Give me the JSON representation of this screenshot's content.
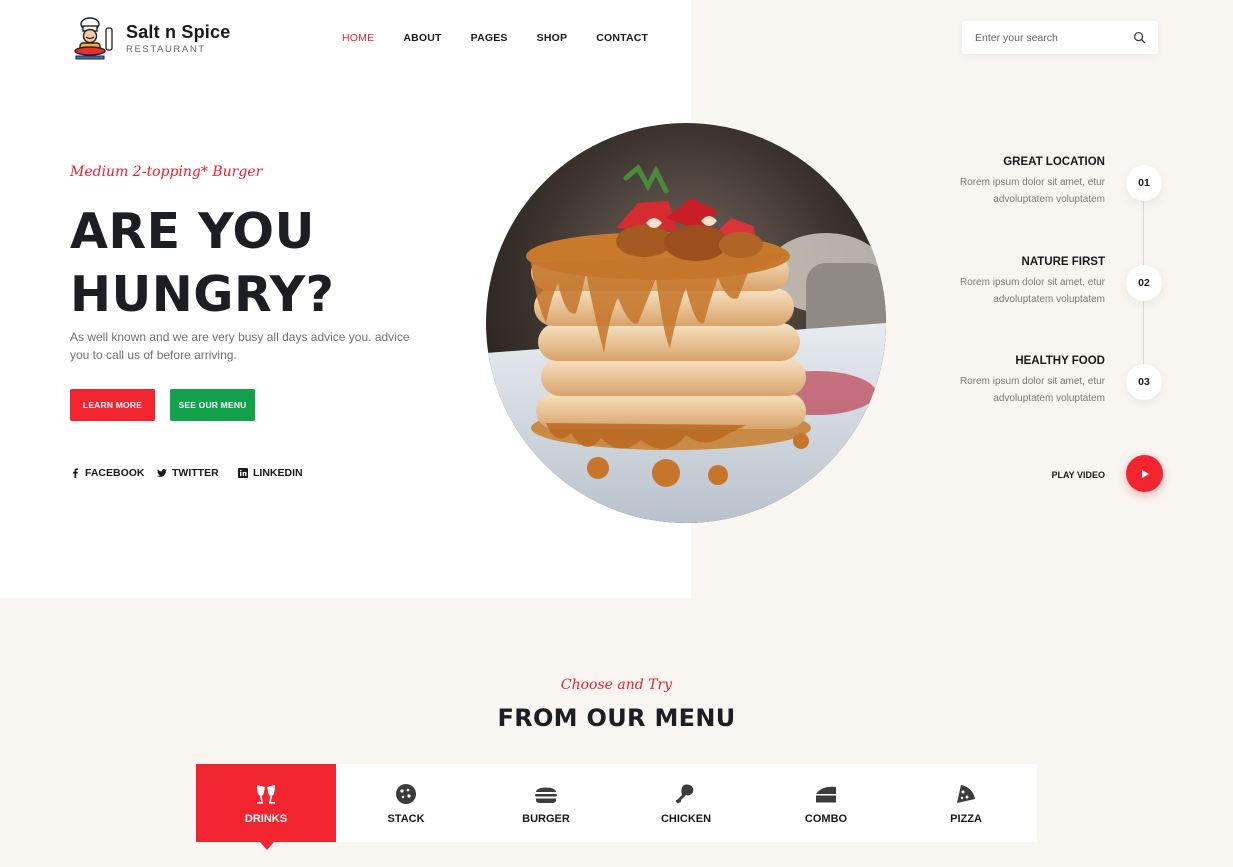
{
  "brand": {
    "name": "Salt n Spice",
    "subtitle": "RESTAURANT",
    "accent_color": "#f22430",
    "secondary_color": "#13a24b"
  },
  "nav": {
    "items": [
      {
        "label": "HOME",
        "active": true
      },
      {
        "label": "ABOUT",
        "active": false
      },
      {
        "label": "PAGES",
        "active": false
      },
      {
        "label": "SHOP",
        "active": false
      },
      {
        "label": "CONTACT",
        "active": false
      }
    ]
  },
  "search": {
    "placeholder": "Enter your search",
    "icon": "search-icon"
  },
  "hero": {
    "tagline": "Medium 2-topping* Burger",
    "headline_line1": "ARE YOU",
    "headline_line2": "HUNGRY?",
    "lead": "As well known and we are very busy all days advice you. advice you to call us of before arriving.",
    "primary_button": "LEARN MORE",
    "secondary_button": "SEE OUR MENU",
    "image": "pancake-stack-photo"
  },
  "social": [
    {
      "label": "FACEBOOK",
      "icon": "facebook-icon"
    },
    {
      "label": "TWITTER",
      "icon": "twitter-icon"
    },
    {
      "label": "LINKEDIN",
      "icon": "linkedin-icon"
    }
  ],
  "features": [
    {
      "number": "01",
      "title": "GREAT LOCATION",
      "text": "Rorem ipsum dolor sit amet, etur advoluptatem voluptatem"
    },
    {
      "number": "02",
      "title": "NATURE FIRST",
      "text": "Rorem ipsum dolor sit amet, etur advoluptatem voluptatem"
    },
    {
      "number": "03",
      "title": "HEALTHY FOOD",
      "text": "Rorem ipsum dolor sit amet, etur advoluptatem voluptatem"
    }
  ],
  "video": {
    "label": "PLAY VIDEO",
    "icon": "play-icon"
  },
  "menu": {
    "subtitle": "Choose and Try",
    "title": "FROM OUR MENU",
    "tabs": [
      {
        "label": "DRINKS",
        "icon": "drinks-icon",
        "active": true
      },
      {
        "label": "STACK",
        "icon": "cookie-icon",
        "active": false
      },
      {
        "label": "BURGER",
        "icon": "burger-icon",
        "active": false
      },
      {
        "label": "CHICKEN",
        "icon": "chicken-leg-icon",
        "active": false
      },
      {
        "label": "COMBO",
        "icon": "cake-slice-icon",
        "active": false
      },
      {
        "label": "PIZZA",
        "icon": "pizza-icon",
        "active": false
      }
    ]
  }
}
